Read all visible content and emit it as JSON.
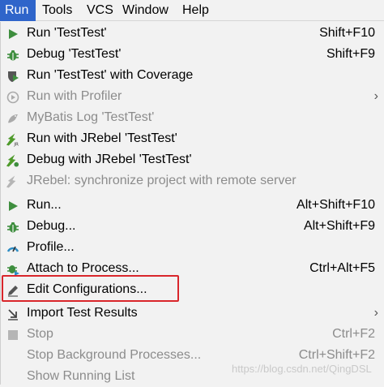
{
  "menubar": {
    "items": [
      {
        "label": "Run",
        "active": true
      },
      {
        "label": "Tools"
      },
      {
        "label": "VCS"
      },
      {
        "label": "Window"
      },
      {
        "label": "Help"
      }
    ]
  },
  "menu": {
    "items": [
      {
        "label": "Run 'TestTest'",
        "shortcut": "Shift+F10",
        "icon": "run-icon"
      },
      {
        "label": "Debug 'TestTest'",
        "shortcut": "Shift+F9",
        "icon": "debug-icon"
      },
      {
        "label": "Run 'TestTest' with Coverage",
        "shortcut": "",
        "icon": "coverage-icon"
      },
      {
        "label": "Run with Profiler",
        "shortcut": "",
        "icon": "profiler-icon",
        "disabled": true,
        "submenu": true
      },
      {
        "label": "MyBatis Log 'TestTest'",
        "shortcut": "",
        "icon": "mybatis-icon",
        "disabled": true
      },
      {
        "label": "Run with JRebel 'TestTest'",
        "shortcut": "",
        "icon": "jrebel-run-icon"
      },
      {
        "label": "Debug with JRebel 'TestTest'",
        "shortcut": "",
        "icon": "jrebel-debug-icon"
      },
      {
        "label": "JRebel: synchronize project with remote server",
        "shortcut": "",
        "icon": "jrebel-sync-icon",
        "disabled": true
      },
      {
        "label": "Run...",
        "shortcut": "Alt+Shift+F10",
        "icon": "run-icon"
      },
      {
        "label": "Debug...",
        "shortcut": "Alt+Shift+F9",
        "icon": "debug-icon"
      },
      {
        "label": "Profile...",
        "shortcut": "",
        "icon": "profile-icon"
      },
      {
        "label": "Attach to Process...",
        "shortcut": "Ctrl+Alt+F5",
        "icon": "attach-icon"
      },
      {
        "label": "Edit Configurations...",
        "shortcut": "",
        "icon": "edit-icon"
      },
      {
        "label": "Import Test Results",
        "shortcut": "",
        "icon": "import-icon",
        "submenu": true
      },
      {
        "label": "Stop",
        "shortcut": "Ctrl+F2",
        "icon": "stop-icon",
        "disabled": true
      },
      {
        "label": "Stop Background Processes...",
        "shortcut": "Ctrl+Shift+F2",
        "icon": "",
        "disabled": true
      },
      {
        "label": "Show Running List",
        "shortcut": "",
        "icon": "",
        "disabled": true
      }
    ]
  },
  "watermark": "https://blog.csdn.net/QingDSL",
  "colors": {
    "accent": "#2f65ca",
    "highlight_border": "#d9262b",
    "run_green": "#3e8e3e",
    "disabled": "#8c8c8c"
  }
}
